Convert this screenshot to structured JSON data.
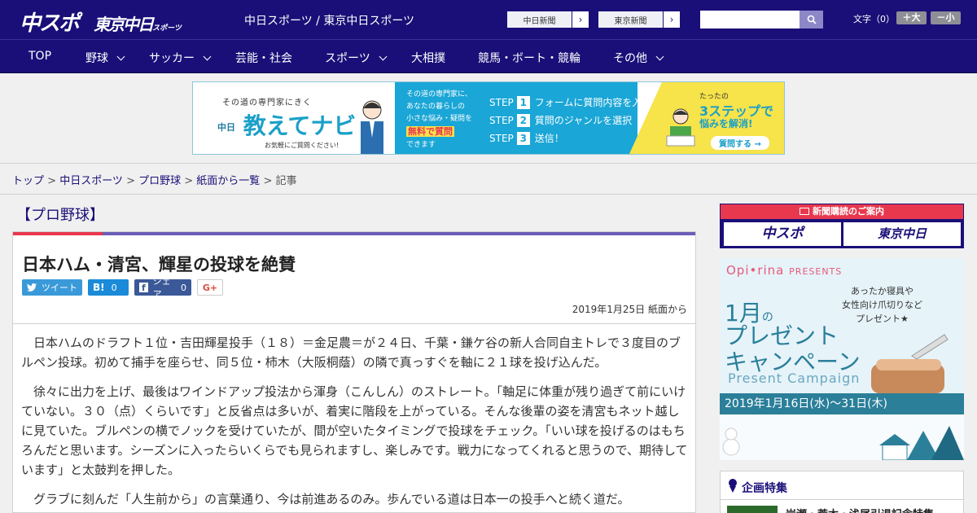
{
  "header": {
    "logo_main": "中スポ",
    "logo_sub": "東京中日",
    "logo_sub_small": "スポーツ",
    "brand_text": "中日スポーツ / 東京中日スポーツ",
    "paper_links": [
      "中日新聞",
      "東京新聞"
    ],
    "search_placeholder": "",
    "font_size_label": "文字（0）",
    "font_plus": "＋大",
    "font_minus": "－小"
  },
  "nav": {
    "items": [
      {
        "label": "TOP",
        "dropdown": false
      },
      {
        "label": "野球",
        "dropdown": true
      },
      {
        "label": "サッカー",
        "dropdown": true
      },
      {
        "label": "芸能・社会",
        "dropdown": false
      },
      {
        "label": "スポーツ",
        "dropdown": true
      },
      {
        "label": "大相撲",
        "dropdown": false
      },
      {
        "label": "競馬・ボート・競輪",
        "dropdown": false
      },
      {
        "label": "その他",
        "dropdown": true
      }
    ]
  },
  "banner": {
    "small": "その道の専門家にきく",
    "title_prefix": "中日",
    "title": "教えてナビ",
    "note": "お気軽にご質問ください!",
    "mid_lines": [
      "その道の専門家に、",
      "あなたの暮らしの",
      "小さな悩み・疑問を",
      "無料で質問",
      "できます"
    ],
    "steps": [
      {
        "num": "1",
        "text": "フォームに質問内容を入力"
      },
      {
        "num": "2",
        "text": "質問のジャンルを選択"
      },
      {
        "num": "3",
        "text": "送信！"
      }
    ],
    "step_word": "STEP",
    "right_small": "たったの",
    "right_big": "3ステップで",
    "right_mid": "悩みを解消!",
    "right_btn": "質問する →"
  },
  "breadcrumb": {
    "items": [
      "トップ",
      "中日スポーツ",
      "プロ野球",
      "紙面から一覧"
    ],
    "current": "記事",
    "sep": " > "
  },
  "article": {
    "section": "【プロ野球】",
    "title": "日本ハム・清宮、輝星の投球を絶賛",
    "share": {
      "tweet": "ツイート",
      "hatena": "B!",
      "hatena_count": "0",
      "fb_label": "シェア",
      "fb_count": "0",
      "gplus": "G+"
    },
    "date": "2019年1月25日 紙面から",
    "paragraphs": [
      "日本ハムのドラフト１位・吉田輝星投手（１８）＝金足農＝が２４日、千葉・鎌ケ谷の新人合同自主トレで３度目のブルペン投球。初めて捕手を座らせ、同５位・柿木（大阪桐蔭）の隣で真っすぐを軸に２１球を投げ込んだ。",
      "徐々に出力を上げ、最後はワインドアップ投法から渾身（こんしん）のストレート。「軸足に体重が残り過ぎて前にいけていない。３０（点）くらいです」と反省点は多いが、着実に階段を上がっている。そんな後輩の姿を清宮もネット越しに見ていた。ブルペンの横でノックを受けていたが、間が空いたタイミングで投球をチェック。「いい球を投げるのはもちろんだと思います。シーズンに入ったらいくらでも見られますし、楽しみです。戦力になってくれると思うので、期待しています」と太鼓判を押した。",
      "グラブに刻んだ「人生前から」の言葉通り、今は前進あるのみ。歩んでいる道は日本一の投手へと続く道だ。"
    ]
  },
  "sidebar": {
    "subscribe_head": "新聞購読のご案内",
    "sub_logo1": "中スポ",
    "sub_logo2": "東京中日",
    "campaign": {
      "brand": "Opi•rina",
      "brand_suffix": "PRESENTS",
      "note_lines": [
        "あったか寝具や",
        "女性向け爪切りなど",
        "プレゼント★"
      ],
      "month": "1月",
      "month_suffix": "の",
      "title_lines": [
        "プレゼント",
        "キャンペーン"
      ],
      "english": "Present Campaign",
      "date": "2019年1月16日(水)〜31日(木)"
    },
    "feature_title": "企画特集",
    "feature_item": "岩瀬・荒木・浅尾引退記念特集"
  }
}
